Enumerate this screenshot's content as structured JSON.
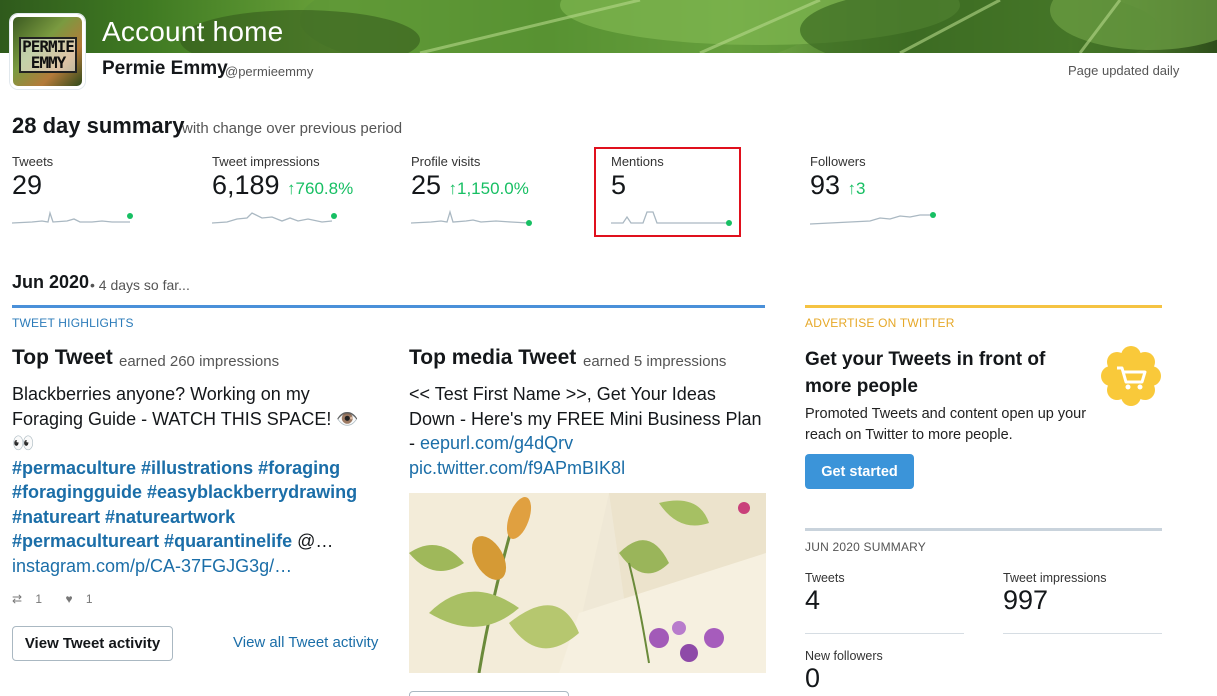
{
  "header": {
    "title": "Account home",
    "avatar_text": "PERMIE EMMY",
    "user_name": "Permie Emmy",
    "user_handle": "@permieemmy",
    "page_updated": "Page updated daily"
  },
  "summary": {
    "title": "28 day summary",
    "subtitle": "with change over previous period",
    "stats": [
      {
        "label": "Tweets",
        "value": "29",
        "change": ""
      },
      {
        "label": "Tweet impressions",
        "value": "6,189",
        "change": "760.8%"
      },
      {
        "label": "Profile visits",
        "value": "25",
        "change": "1,150.0%"
      },
      {
        "label": "Mentions",
        "value": "5",
        "change": ""
      },
      {
        "label": "Followers",
        "value": "93",
        "change": "3"
      }
    ]
  },
  "month": {
    "title": "Jun 2020",
    "subtitle": "• 4 days so far..."
  },
  "highlights": {
    "label": "TWEET HIGHLIGHTS",
    "top_tweet": {
      "title": "Top Tweet",
      "earned": "earned 260 impressions",
      "text": "Blackberries anyone? Working on my Foraging Guide - WATCH THIS SPACE! 👁️👀",
      "hashtags_1": "#permaculture #illustrations #foraging",
      "hashtags_2": "#foragingguide #easyblackberrydrawing",
      "hashtags_3": "#natureart #natureartwork",
      "hashtags_4": "#permacultureart #quarantinelife",
      "hashtags_4_tail": " @…",
      "link": "instagram.com/p/CA-37FGJG3g/…",
      "retweets": "1",
      "likes": "1",
      "view_activity_button": "View Tweet activity",
      "view_all_link": "View all Tweet activity"
    },
    "top_media_tweet": {
      "title": "Top media Tweet",
      "earned": "earned 5 impressions",
      "text_1": "<< Test First Name >>, Get Your Ideas",
      "text_2": "Down - Here's my FREE Mini Business Plan",
      "text_3": "- ",
      "link_1": "eepurl.com/g4dQrv",
      "link_2": "pic.twitter.com/f9APmBIK8l"
    }
  },
  "advertise": {
    "label": "ADVERTISE ON TWITTER",
    "title": "Get your Tweets in front of more people",
    "text": "Promoted Tweets and content open up your reach on Twitter to more people.",
    "button": "Get started"
  },
  "month_summary": {
    "label": "JUN 2020 SUMMARY",
    "tweets_label": "Tweets",
    "tweets_value": "4",
    "impressions_label": "Tweet impressions",
    "impressions_value": "997",
    "followers_label": "New followers",
    "followers_value": "0"
  },
  "colors": {
    "positive": "#17bf63",
    "link": "#1b6ea8",
    "highlight_box": "#e0101d",
    "primary_button": "#3b94d9"
  }
}
